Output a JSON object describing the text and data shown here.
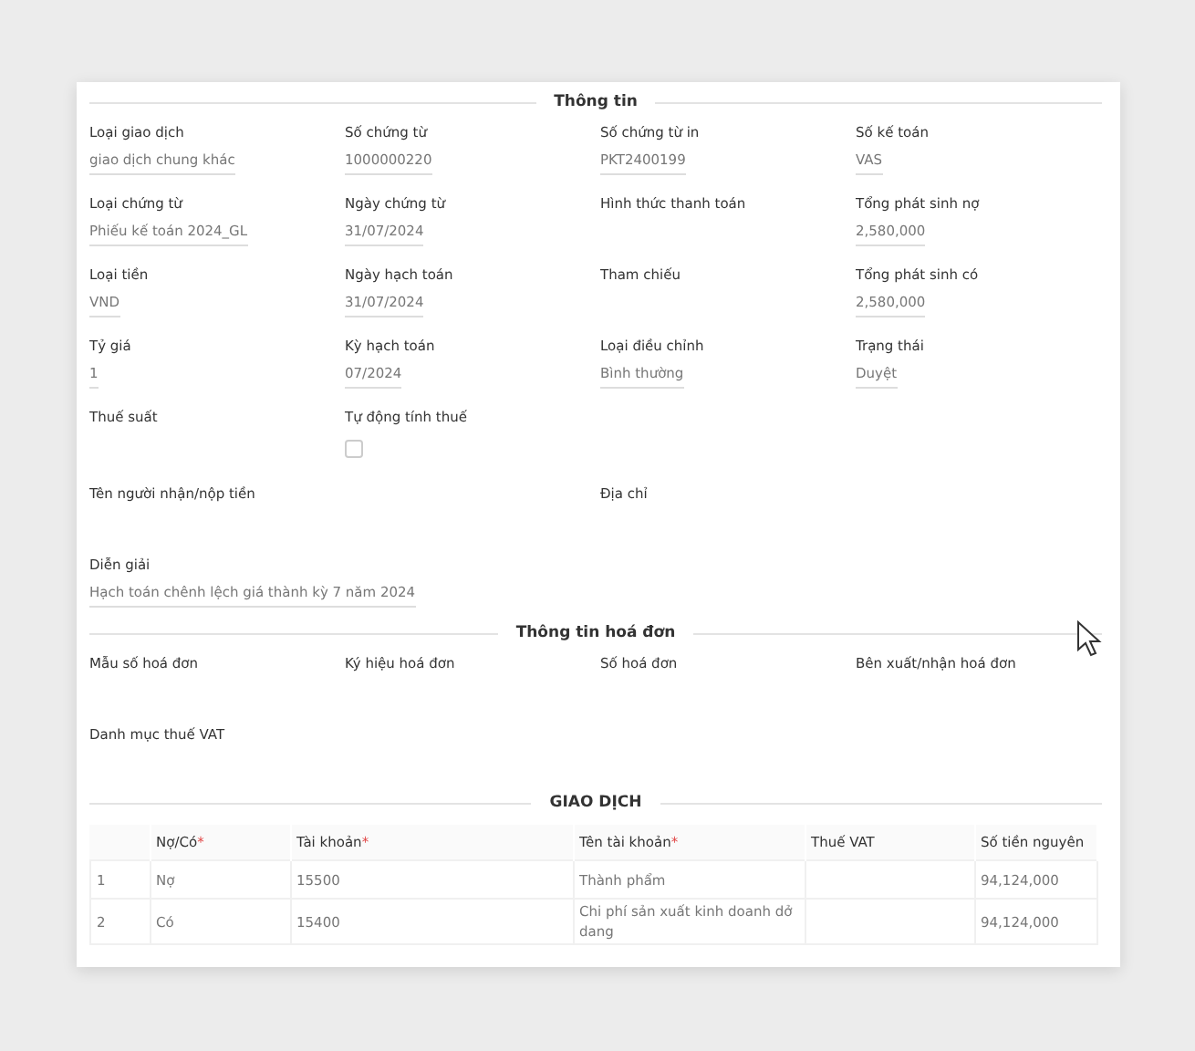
{
  "info": {
    "title": "Thông tin",
    "fields": [
      {
        "kind": "text",
        "label": "Loại giao dịch",
        "value": "giao dịch chung khác"
      },
      {
        "kind": "text",
        "label": "Số chứng từ",
        "value": "1000000220"
      },
      {
        "kind": "text",
        "label": "Số chứng từ in",
        "value": "PKT2400199"
      },
      {
        "kind": "text",
        "label": "Số kế toán",
        "value": "VAS"
      },
      {
        "kind": "text",
        "label": "Loại chứng từ",
        "value": "Phiếu kế toán 2024_GL"
      },
      {
        "kind": "text",
        "label": "Ngày chứng từ",
        "value": "31/07/2024"
      },
      {
        "kind": "text",
        "label": "Hình thức thanh toán"
      },
      {
        "kind": "text",
        "label": "Tổng phát sinh nợ",
        "value": "2,580,000"
      },
      {
        "kind": "text",
        "label": "Loại tiền",
        "value": "VND"
      },
      {
        "kind": "text",
        "label": "Ngày hạch toán",
        "value": "31/07/2024"
      },
      {
        "kind": "text",
        "label": "Tham chiếu"
      },
      {
        "kind": "text",
        "label": "Tổng phát sinh có",
        "value": "2,580,000"
      },
      {
        "kind": "text",
        "label": "Tỷ giá",
        "value": "1"
      },
      {
        "kind": "text",
        "label": "Kỳ hạch toán",
        "value": "07/2024"
      },
      {
        "kind": "text",
        "label": "Loại điều chỉnh",
        "value": "Bình thường"
      },
      {
        "kind": "text",
        "label": "Trạng thái",
        "value": "Duyệt"
      },
      {
        "kind": "text",
        "label": "Thuế suất"
      },
      {
        "kind": "checkbox",
        "label": "Tự động tính thuế",
        "checked": false
      },
      {
        "kind": "break"
      },
      {
        "kind": "wide",
        "label": "Tên người nhận/nộp tiền"
      },
      {
        "kind": "wide",
        "label": "Địa chỉ"
      },
      {
        "kind": "wide",
        "label": "Diễn giải",
        "value": "Hạch toán chênh lệch giá thành kỳ 7 năm 2024"
      },
      {
        "kind": "break"
      }
    ]
  },
  "invoice": {
    "title": "Thông tin hoá đơn",
    "fields": [
      {
        "kind": "text",
        "label": "Mẫu số hoá đơn"
      },
      {
        "kind": "text",
        "label": "Ký hiệu hoá đơn"
      },
      {
        "kind": "text",
        "label": "Số hoá đơn"
      },
      {
        "kind": "text",
        "label": "Bên xuất/nhận hoá đơn"
      },
      {
        "kind": "wide",
        "label": "Danh mục thuế VAT"
      },
      {
        "kind": "break"
      }
    ]
  },
  "transactions": {
    "title": "GIAO DỊCH",
    "columns": [
      {},
      {
        "label": "Nợ/Có",
        "required_mark": "*"
      },
      {
        "label": "Tài khoản",
        "required_mark": "*"
      },
      {
        "label": "Tên tài khoản",
        "required_mark": "*"
      },
      {
        "label": "Thuế VAT"
      },
      {
        "label": "Số tiền nguyên"
      }
    ],
    "rows": [
      [
        "1",
        "Nợ",
        "15500",
        "Thành phẩm",
        "",
        "94,124,000"
      ],
      [
        "2",
        "Có",
        "15400",
        "Chi phí sản xuất kinh doanh dở dang",
        "",
        "94,124,000"
      ]
    ]
  }
}
